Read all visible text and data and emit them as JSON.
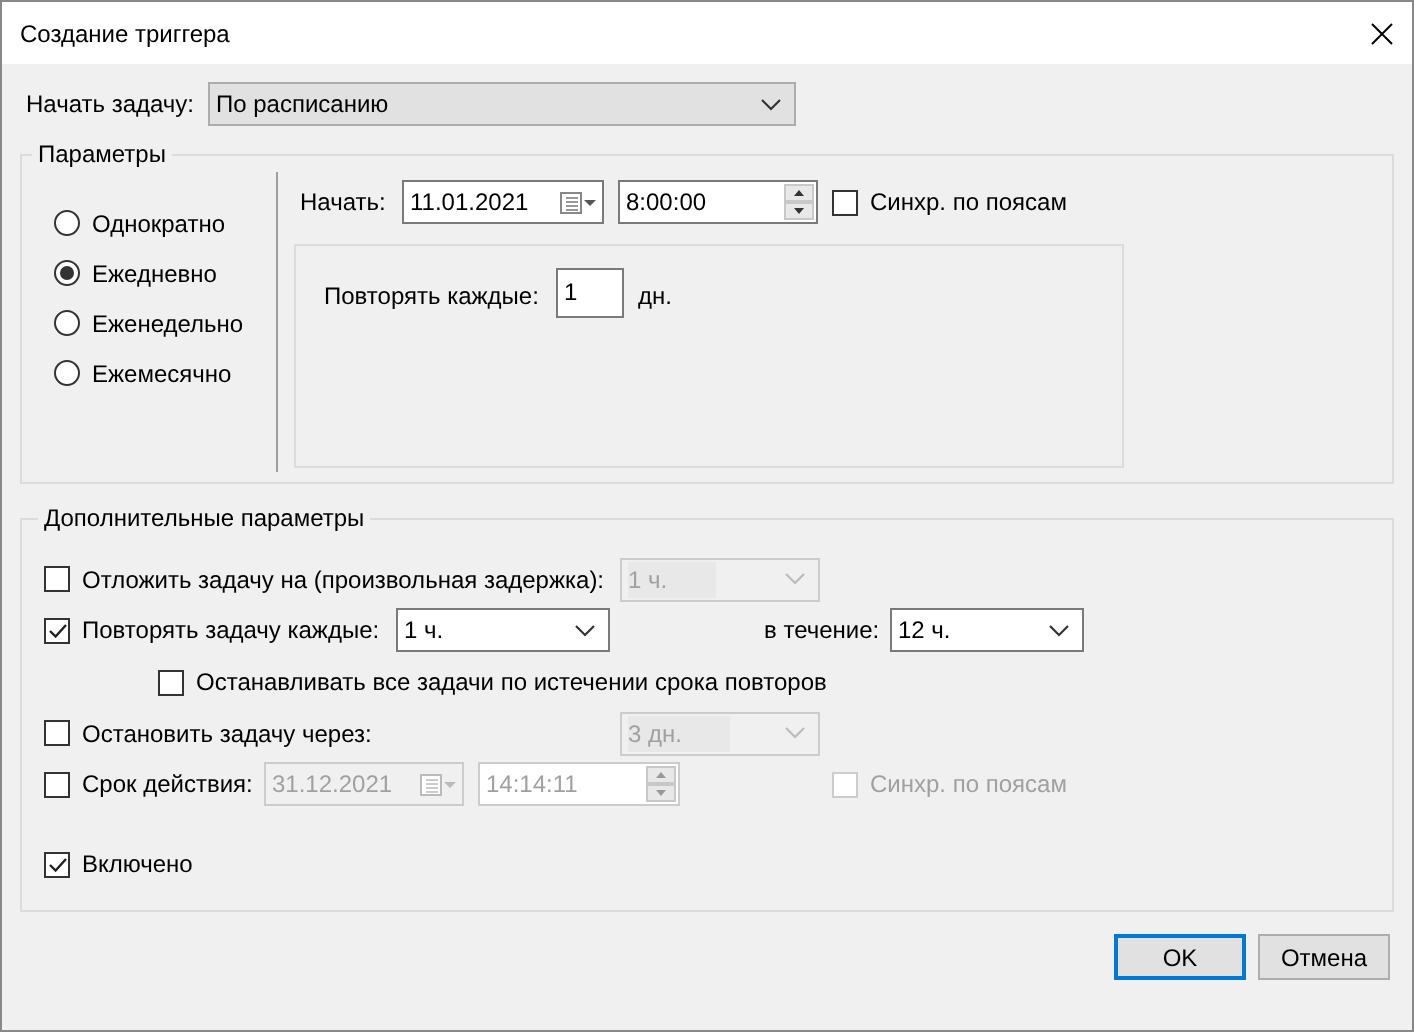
{
  "window": {
    "title": "Создание триггера"
  },
  "start_task": {
    "label": "Начать задачу:",
    "value": "По расписанию"
  },
  "parameters": {
    "title": "Параметры",
    "schedule": [
      {
        "label": "Однократно",
        "selected": false
      },
      {
        "label": "Ежедневно",
        "selected": true
      },
      {
        "label": "Еженедельно",
        "selected": false
      },
      {
        "label": "Ежемесячно",
        "selected": false
      }
    ],
    "start": {
      "label": "Начать:",
      "date": "11.01.2021",
      "time": "8:00:00",
      "sync": {
        "label": "Синхр. по поясам",
        "checked": false
      }
    },
    "repeat": {
      "label": "Повторять каждые:",
      "value": "1",
      "unit": "дн."
    }
  },
  "advanced": {
    "title": "Дополнительные параметры",
    "delay": {
      "label": "Отложить задачу на (произвольная задержка):",
      "checked": false,
      "value": "1 ч.",
      "disabled": true
    },
    "repeat_task": {
      "label": "Повторять задачу каждые:",
      "checked": true,
      "value": "1 ч.",
      "duration_label": "в течение:",
      "duration_value": "12 ч."
    },
    "stop_all": {
      "label": "Останавливать все задачи по истечении срока повторов",
      "checked": false
    },
    "stop_after": {
      "label": "Остановить задачу через:",
      "checked": false,
      "value": "3 дн.",
      "disabled": true
    },
    "expiry": {
      "label": "Срок действия:",
      "checked": false,
      "date": "31.12.2021",
      "time": "14:14:11",
      "disabled": true,
      "sync": {
        "label": "Синхр. по поясам",
        "checked": false,
        "disabled": true
      }
    },
    "enabled": {
      "label": "Включено",
      "checked": true
    }
  },
  "buttons": [
    {
      "label": "OK",
      "default": true
    },
    {
      "label": "Отмена",
      "default": false
    }
  ]
}
